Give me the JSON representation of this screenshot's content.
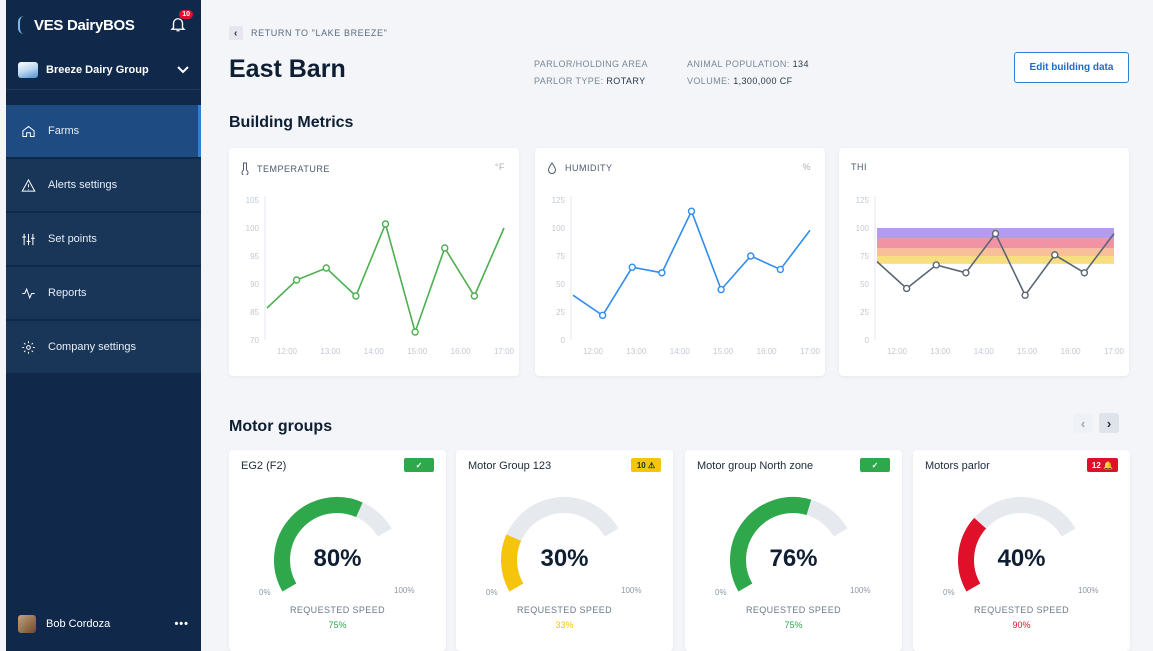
{
  "app": {
    "logo_text": "VES DairyBOS",
    "notifications_count": "10"
  },
  "company": {
    "name": "Breeze Dairy Group"
  },
  "sidebar": {
    "items": [
      {
        "label": "Farms",
        "icon": "home-icon",
        "active": true
      },
      {
        "label": "Alerts settings",
        "icon": "alert-triangle-icon",
        "active": false
      },
      {
        "label": "Set points",
        "icon": "sliders-icon",
        "active": false
      },
      {
        "label": "Reports",
        "icon": "activity-icon",
        "active": false
      },
      {
        "label": "Company settings",
        "icon": "gear-icon",
        "active": false
      }
    ],
    "user": {
      "name": "Bob Cordoza",
      "more": "•••"
    }
  },
  "header": {
    "back_label": "RETURN TO \"LAKE BREEZE\"",
    "title": "East Barn",
    "meta_1_line1": "PARLOR/HOLDING AREA",
    "meta_1_line2_label": "PARLOR TYPE:",
    "meta_1_line2_value": "ROTARY",
    "meta_2_line1_label": "ANIMAL POPULATION:",
    "meta_2_line1_value": "134",
    "meta_2_line2_label": "VOLUME:",
    "meta_2_line2_value": "1,300,000 CF",
    "edit_button": "Edit building data"
  },
  "metrics": {
    "section_title": "Building Metrics"
  },
  "chart_data": [
    {
      "type": "line",
      "title": "TEMPERATURE",
      "unit": "°F",
      "icon": "thermometer-icon",
      "color": "#4caf50",
      "ylim": [
        70,
        105
      ],
      "yticks": [
        "105",
        "100",
        "95",
        "90",
        "85",
        "70"
      ],
      "xticks": [
        "12:00",
        "13:00",
        "14:00",
        "15:00",
        "16:00",
        "17:00"
      ],
      "x": [
        0,
        1,
        2,
        3,
        4,
        5,
        6,
        7,
        8
      ],
      "values": [
        78,
        85,
        88,
        81,
        99,
        72,
        93,
        81,
        98
      ]
    },
    {
      "type": "line",
      "title": "HUMIDITY",
      "unit": "%",
      "icon": "droplet-icon",
      "color": "#2f8cf0",
      "ylim": [
        0,
        125
      ],
      "yticks": [
        "125",
        "100",
        "75",
        "50",
        "25",
        "0"
      ],
      "xticks": [
        "12:00",
        "13:00",
        "14:00",
        "15:00",
        "16:00",
        "17:00"
      ],
      "x": [
        0,
        1,
        2,
        3,
        4,
        5,
        6,
        7,
        8
      ],
      "values": [
        40,
        22,
        65,
        60,
        115,
        45,
        75,
        63,
        98
      ]
    },
    {
      "type": "line",
      "title": "THI",
      "unit": "",
      "icon": "",
      "color": "#5b6675",
      "ylim": [
        0,
        125
      ],
      "yticks": [
        "125",
        "100",
        "75",
        "50",
        "25",
        "0"
      ],
      "xticks": [
        "12:00",
        "13:00",
        "14:00",
        "15:00",
        "16:00",
        "17:00"
      ],
      "bands": [
        {
          "from": 68,
          "to": 75,
          "color": "#f6d86a"
        },
        {
          "from": 75,
          "to": 82,
          "color": "#f7b487"
        },
        {
          "from": 82,
          "to": 91,
          "color": "#ef7f95"
        },
        {
          "from": 91,
          "to": 100,
          "color": "#a78be6"
        }
      ],
      "x": [
        0,
        1,
        2,
        3,
        4,
        5,
        6,
        7,
        8
      ],
      "values": [
        70,
        46,
        67,
        60,
        95,
        40,
        76,
        60,
        95
      ]
    }
  ],
  "motors": {
    "section_title": "Motor groups",
    "prev": "‹",
    "next": "›",
    "gauge_min": "0%",
    "gauge_max": "100%",
    "gauge_label": "REQUESTED SPEED",
    "cards": [
      {
        "name": "EG2 (F2)",
        "badge_type": "ok",
        "badge_text": "✓",
        "percent": "80%",
        "fraction": 0.8,
        "color": "#2fa84b",
        "requested": "75%",
        "requested_color": "#2fa84b"
      },
      {
        "name": "Motor Group 123",
        "badge_type": "warn",
        "badge_text": "10 ⚠",
        "percent": "30%",
        "fraction": 0.3,
        "color": "#f5c40d",
        "requested": "33%",
        "requested_color": "#f5c40d"
      },
      {
        "name": "Motor group North zone",
        "badge_type": "ok",
        "badge_text": "✓",
        "percent": "76%",
        "fraction": 0.76,
        "color": "#2fa84b",
        "requested": "75%",
        "requested_color": "#2fa84b"
      },
      {
        "name": "Motors parlor",
        "badge_type": "alert",
        "badge_text": "12 🔔",
        "percent": "40%",
        "fraction": 0.4,
        "color": "#e0102a",
        "requested": "90%",
        "requested_color": "#e0102a"
      }
    ]
  }
}
